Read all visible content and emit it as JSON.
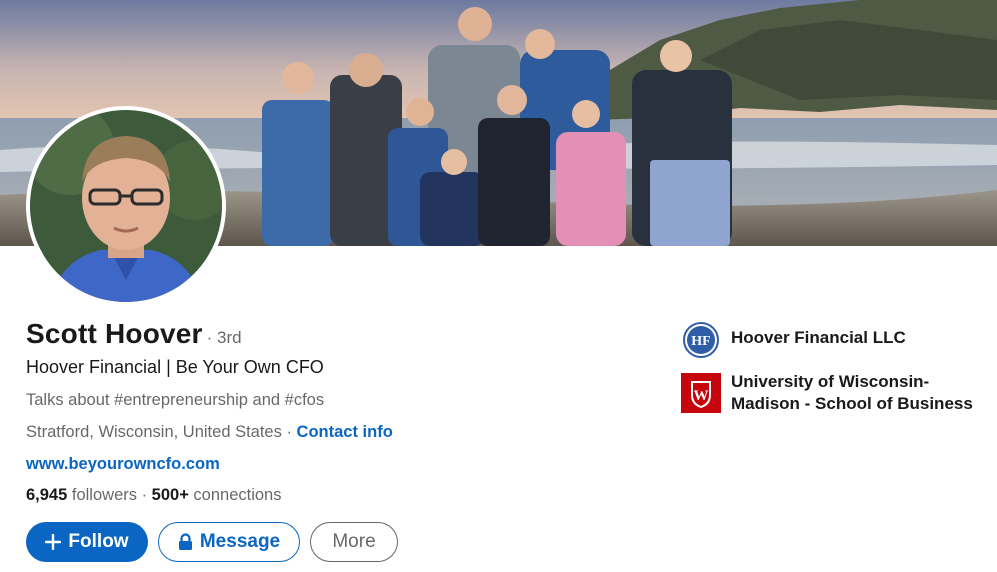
{
  "profile": {
    "name": "Scott Hoover",
    "degree": "· 3rd",
    "headline": "Hoover Financial | Be Your Own CFO",
    "talks_about": "Talks about #entrepreneurship and #cfos",
    "location": "Stratford, Wisconsin, United States",
    "location_separator": " · ",
    "contact_info_label": "Contact info",
    "website": "www.beyourowncfo.com",
    "followers_count": "6,945",
    "followers_label": " followers ",
    "stats_separator": " · ",
    "connections": "500+",
    "connections_label": " connections"
  },
  "actions": {
    "follow_label": "Follow",
    "message_label": "Message",
    "more_label": "More"
  },
  "orgs": [
    {
      "name": "Hoover Financial LLC",
      "logo_text": "HF",
      "icon": "hoover-financial-logo"
    },
    {
      "name": "University of Wisconsin-Madison - School of Business",
      "logo_text": "W",
      "icon": "uw-madison-crest-logo"
    }
  ],
  "colors": {
    "link_blue": "#0a66c2",
    "uw_red": "#c5050c",
    "text_secondary": "rgba(0,0,0,0.6)"
  }
}
